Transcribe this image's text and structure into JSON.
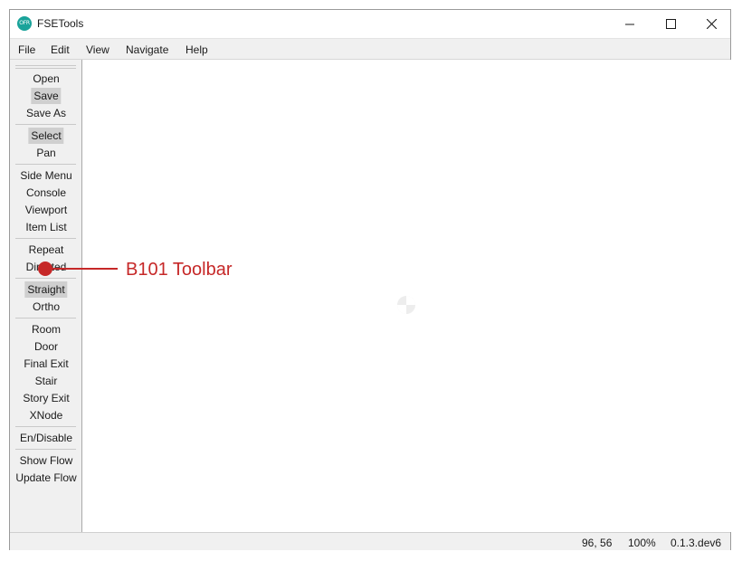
{
  "window": {
    "title": "FSETools",
    "app_icon_text": "OFR",
    "controls": [
      "minimize",
      "maximize",
      "close"
    ]
  },
  "menu": [
    "File",
    "Edit",
    "View",
    "Navigate",
    "Help"
  ],
  "toolbar": {
    "groups": [
      [
        {
          "label": "Open",
          "active": false
        },
        {
          "label": "Save",
          "active": true
        },
        {
          "label": "Save As",
          "active": false
        }
      ],
      [
        {
          "label": "Select",
          "active": true
        },
        {
          "label": "Pan",
          "active": false
        }
      ],
      [
        {
          "label": "Side Menu",
          "active": false
        },
        {
          "label": "Console",
          "active": false
        },
        {
          "label": "Viewport",
          "active": false
        },
        {
          "label": "Item List",
          "active": false
        }
      ],
      [
        {
          "label": "Repeat",
          "active": false
        },
        {
          "label": "Directed",
          "active": false
        }
      ],
      [
        {
          "label": "Straight",
          "active": true
        },
        {
          "label": "Ortho",
          "active": false
        }
      ],
      [
        {
          "label": "Room",
          "active": false
        },
        {
          "label": "Door",
          "active": false
        },
        {
          "label": "Final Exit",
          "active": false
        },
        {
          "label": "Stair",
          "active": false
        },
        {
          "label": "Story Exit",
          "active": false
        },
        {
          "label": "XNode",
          "active": false
        }
      ],
      [
        {
          "label": "En/Disable",
          "active": false
        }
      ],
      [
        {
          "label": "Show Flow",
          "active": false
        },
        {
          "label": "Update Flow",
          "active": false
        }
      ]
    ]
  },
  "status": {
    "coords": "96, 56",
    "zoom": "100%",
    "version": "0.1.3.dev6"
  },
  "annotation": {
    "label": "B101 Toolbar",
    "color": "#c62828"
  }
}
